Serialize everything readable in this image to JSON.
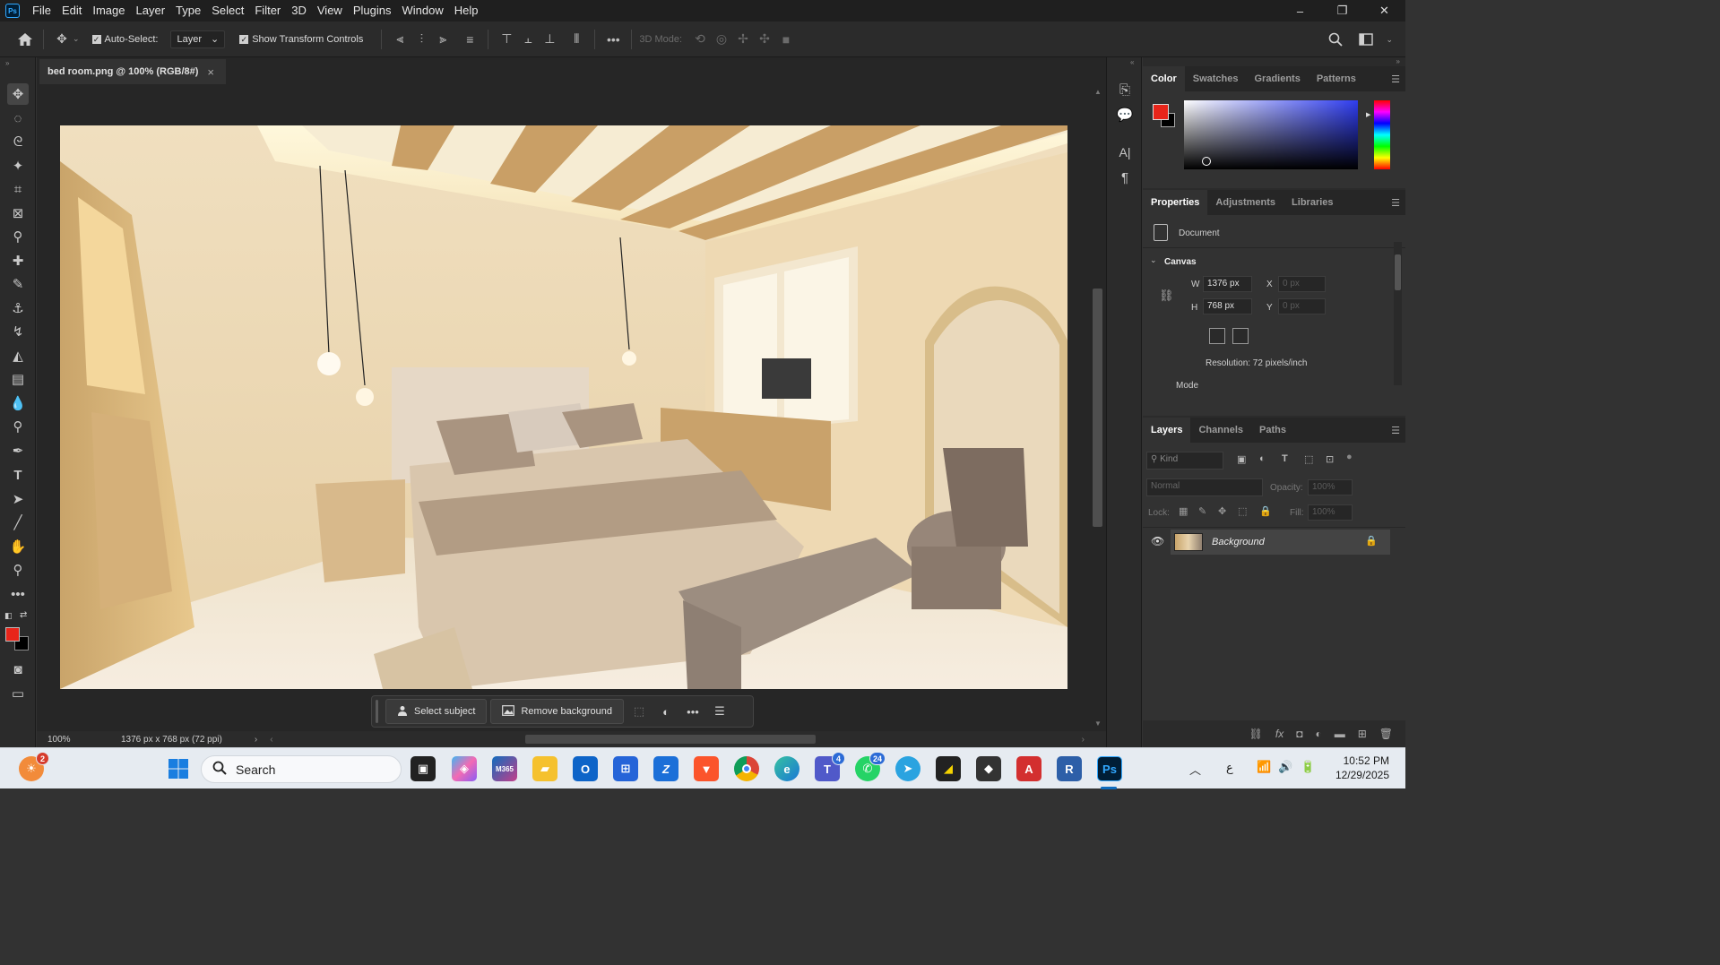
{
  "app": {
    "menu": [
      "File",
      "Edit",
      "Image",
      "Layer",
      "Type",
      "Select",
      "Filter",
      "3D",
      "View",
      "Plugins",
      "Window",
      "Help"
    ],
    "logo_text": "Ps",
    "window_buttons": {
      "minimize": "–",
      "restore": "❐",
      "close": "✕"
    }
  },
  "options_bar": {
    "auto_select_label": "Auto-Select:",
    "auto_select_target": "Layer",
    "show_transform_label": "Show Transform Controls",
    "mode_3d_label": "3D Mode:"
  },
  "document": {
    "tab_title": "bed room.png @ 100% (RGB/8#)",
    "close_glyph": "×"
  },
  "context_bar": {
    "select_subject": "Select subject",
    "remove_background": "Remove background"
  },
  "status": {
    "zoom": "100%",
    "doc_info": "1376 px x 768 px (72 ppi)"
  },
  "color_panel": {
    "tabs": [
      "Color",
      "Swatches",
      "Gradients",
      "Patterns"
    ],
    "foreground": "#e8251a",
    "background": "#000000"
  },
  "properties_panel": {
    "tabs": [
      "Properties",
      "Adjustments",
      "Libraries"
    ],
    "document_label": "Document",
    "canvas_label": "Canvas",
    "w_label": "W",
    "w_value": "1376 px",
    "h_label": "H",
    "h_value": "768 px",
    "x_label": "X",
    "x_placeholder": "0 px",
    "y_label": "Y",
    "y_placeholder": "0 px",
    "resolution": "Resolution: 72 pixels/inch",
    "mode_label": "Mode"
  },
  "layers_panel": {
    "tabs": [
      "Layers",
      "Channels",
      "Paths"
    ],
    "filter_kind": "Kind",
    "blend_mode": "Normal",
    "opacity_label": "Opacity:",
    "opacity_value": "100%",
    "lock_label": "Lock:",
    "fill_label": "Fill:",
    "fill_value": "100%",
    "layers": [
      {
        "name": "Background",
        "visible": true,
        "locked": true
      }
    ]
  },
  "taskbar": {
    "search_placeholder": "Search",
    "time": "10:52 PM",
    "date": "12/29/2025",
    "weather_badge": "2",
    "teams_badge": "4",
    "whatsapp_badge": "24",
    "lang": "ع"
  }
}
